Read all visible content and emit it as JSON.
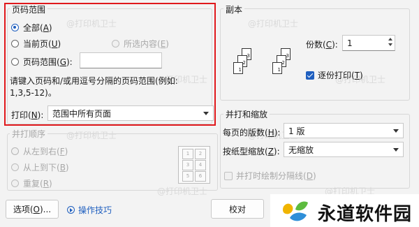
{
  "page_range": {
    "title": "页码范围",
    "all": {
      "text": "全部(",
      "key": "A",
      "end": ")"
    },
    "current": {
      "text": "当前页(",
      "key": "U",
      "end": ")"
    },
    "selection": {
      "text": "所选内容(",
      "key": "E",
      "end": ")"
    },
    "pages": {
      "text": "页码范围(",
      "key": "G",
      "end": "):"
    },
    "pages_value": "",
    "hint_line1": "请键入页码和/或用逗号分隔的页码范围(例如:",
    "hint_line2": "1,3,5-12)。"
  },
  "print_what": {
    "label": "打印(",
    "key": "N",
    "end": "):",
    "value": "范围中所有页面"
  },
  "print_order": {
    "title": "并打顺序",
    "left_to_right": {
      "text": "从左到右(",
      "key": "F",
      "end": ")"
    },
    "top_to_bottom": {
      "text": "从上到下(",
      "key": "B",
      "end": ")"
    },
    "repeat": {
      "text": "重复(",
      "key": "R",
      "end": ")"
    },
    "order_pages": [
      "1",
      "2",
      "3",
      "4",
      "5",
      "6"
    ]
  },
  "copies": {
    "title": "副本",
    "count_label": {
      "text": "份数(",
      "key": "C",
      "end": "):"
    },
    "count_value": "1",
    "collate": {
      "text": "逐份打印(",
      "key": "T",
      "end": ")"
    },
    "stack_pages": [
      "1",
      "2",
      "3"
    ]
  },
  "zoom": {
    "title": "并打和缩放",
    "pages_per_sheet": {
      "text": "每页的版数(",
      "key": "H",
      "end": "):",
      "value": "1 版"
    },
    "scale_to_paper": {
      "text": "按纸型缩放(",
      "key": "Z",
      "end": "):",
      "value": "无缩放"
    },
    "draw_borders": {
      "text": "并打时绘制分隔线(",
      "key": "D",
      "end": ")"
    }
  },
  "buttons": {
    "options": {
      "text": "选项(",
      "key": "O",
      "end": ")..."
    },
    "tips": "操作技巧",
    "proof": "校对"
  },
  "watermark_text": "@打印机卫士",
  "brand": {
    "name": "永道软件园"
  },
  "colors": {
    "highlight": "#e0181c",
    "accent": "#1f5fbf"
  }
}
